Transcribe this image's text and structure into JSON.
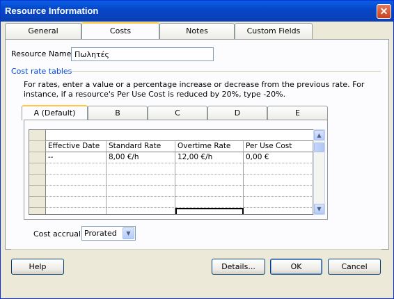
{
  "window": {
    "title": "Resource Information",
    "close_label": "✕"
  },
  "tabs": [
    {
      "label": "General",
      "active": false
    },
    {
      "label": "Costs",
      "active": true
    },
    {
      "label": "Notes",
      "active": false
    },
    {
      "label": "Custom Fields",
      "active": false
    }
  ],
  "resource_name": {
    "label": "Resource Name:",
    "value": "Πωλητές"
  },
  "cost_rate_tables": {
    "heading": "Cost rate tables",
    "description": "For rates, enter a value or a percentage increase or decrease from the previous rate. For instance, if a resource's Per Use Cost is reduced by 20%, type -20%."
  },
  "rate_tabs": [
    {
      "label": "A (Default)",
      "active": true
    },
    {
      "label": "B",
      "active": false
    },
    {
      "label": "C",
      "active": false
    },
    {
      "label": "D",
      "active": false
    },
    {
      "label": "E",
      "active": false
    }
  ],
  "grid": {
    "columns": [
      "Effective Date",
      "Standard Rate",
      "Overtime Rate",
      "Per Use Cost"
    ],
    "rows": [
      [
        "--",
        "8,00 €/h",
        "12,00 €/h",
        "0,00 €"
      ]
    ]
  },
  "cost_accrual": {
    "label": "Cost accrual:",
    "value": "Prorated"
  },
  "buttons": {
    "help": "Help",
    "details": "Details...",
    "ok": "OK",
    "cancel": "Cancel"
  },
  "icons": {
    "scroll_up": "▲",
    "scroll_down": "▼",
    "dropdown": "▼"
  }
}
